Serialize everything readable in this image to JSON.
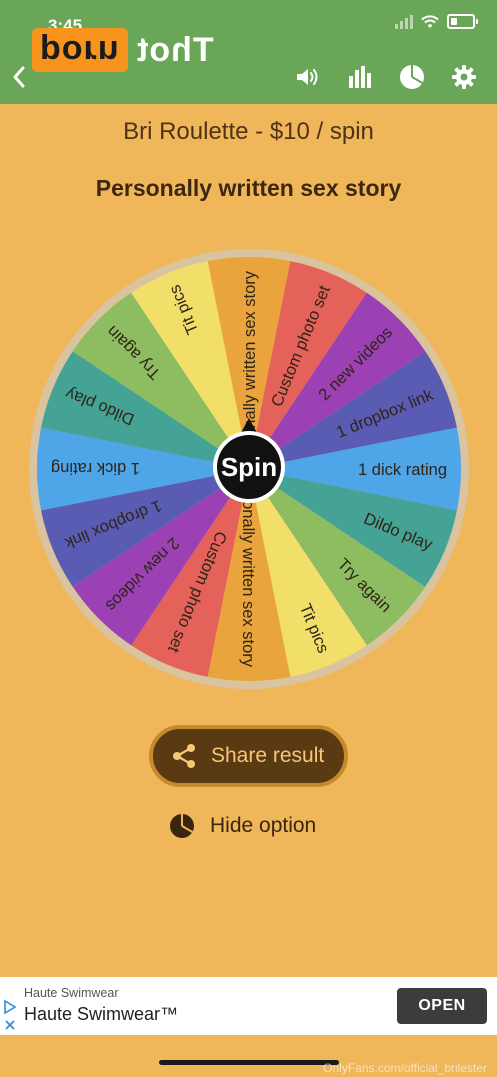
{
  "status_bar": {
    "time": "3:45"
  },
  "header": {
    "logo_part1": "porn",
    "logo_part2": "Thot",
    "icons": [
      "back-icon",
      "volume-icon",
      "stats-icon",
      "pie-chart-icon",
      "gear-icon"
    ]
  },
  "title": "Bri Roulette - $10 / spin",
  "result": "Personally written sex story",
  "wheel": {
    "center_label": "Spin",
    "segments": [
      {
        "label": "Personally written sex story",
        "color": "#e9a43e"
      },
      {
        "label": "Custom photo set",
        "color": "#e4625a"
      },
      {
        "label": "2 new videos",
        "color": "#9b41b3"
      },
      {
        "label": "1 dropbox link",
        "color": "#5a5cb4"
      },
      {
        "label": "1 dick rating",
        "color": "#4ea5e8"
      },
      {
        "label": "Dildo play",
        "color": "#44a394"
      },
      {
        "label": "Try again",
        "color": "#8dbd60"
      },
      {
        "label": "Tit pics",
        "color": "#f2df6a"
      },
      {
        "label": "Personally written sex story",
        "color": "#e9a43e"
      },
      {
        "label": "Custom photo set",
        "color": "#e4625a"
      },
      {
        "label": "2 new videos",
        "color": "#9b41b3"
      },
      {
        "label": "1 dropbox link",
        "color": "#5a5cb4"
      },
      {
        "label": "1 dick rating",
        "color": "#4ea5e8"
      },
      {
        "label": "Dildo play",
        "color": "#44a394"
      },
      {
        "label": "Try again",
        "color": "#8dbd60"
      },
      {
        "label": "Tit pics",
        "color": "#f2df6a"
      }
    ]
  },
  "share_button": {
    "label": "Share result"
  },
  "hide_option": {
    "label": "Hide option"
  },
  "ad": {
    "advertiser": "Haute Swimwear",
    "headline": "Haute Swimwear™",
    "button": "OPEN"
  },
  "watermark": "OnlyFans.com/official_brilester"
}
